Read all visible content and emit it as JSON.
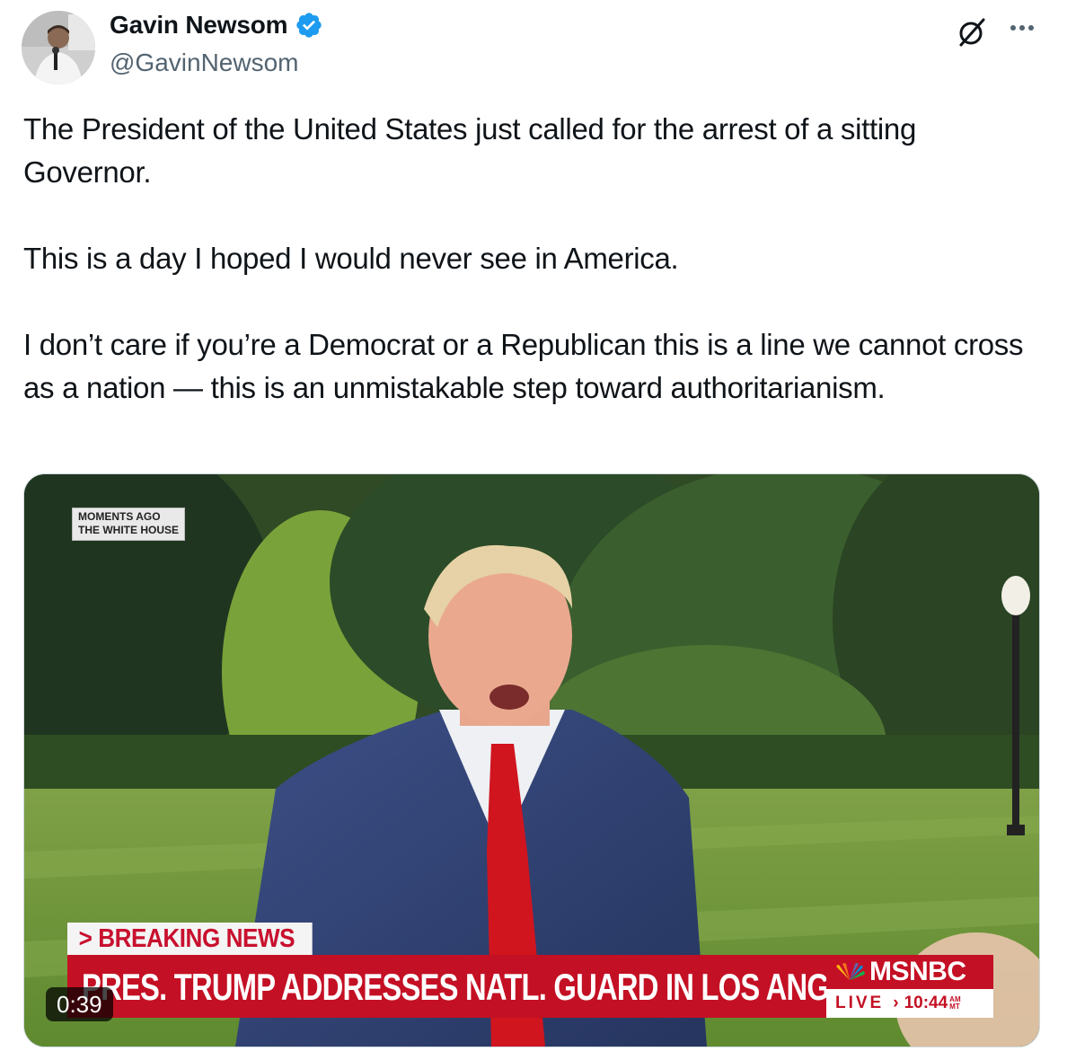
{
  "author": {
    "name": "Gavin Newsom",
    "handle": "@GavinNewsom",
    "verified": true,
    "avatar_icon": "profile-photo"
  },
  "actions": {
    "grok_icon": "grok-icon",
    "more_icon": "more-icon"
  },
  "tweet": {
    "paragraphs": [
      "The President of the United States just called for the arrest of a sitting Governor.",
      "This is a day I hoped I would never see in America.",
      "I don’t care if you’re a Democrat or a Republican this is a line we cannot cross as a nation — this is an unmistakable step toward authoritarianism."
    ]
  },
  "video": {
    "location_tag": [
      "MOMENTS AGO",
      "THE WHITE HOUSE"
    ],
    "breaking_label": "> BREAKING NEWS",
    "headline": "PRES. TRUMP ADDRESSES NATL. GUARD IN LOS ANGELES",
    "network": "MSNBC",
    "live_label": "LIVE",
    "live_chevron": "›",
    "time": "10:44",
    "time_suffix": [
      "AM",
      "MT"
    ],
    "duration": "0:39"
  },
  "colors": {
    "text": "#0f1419",
    "secondary": "#536471",
    "verified": "#1d9bf0",
    "news_red": "#c41024"
  }
}
